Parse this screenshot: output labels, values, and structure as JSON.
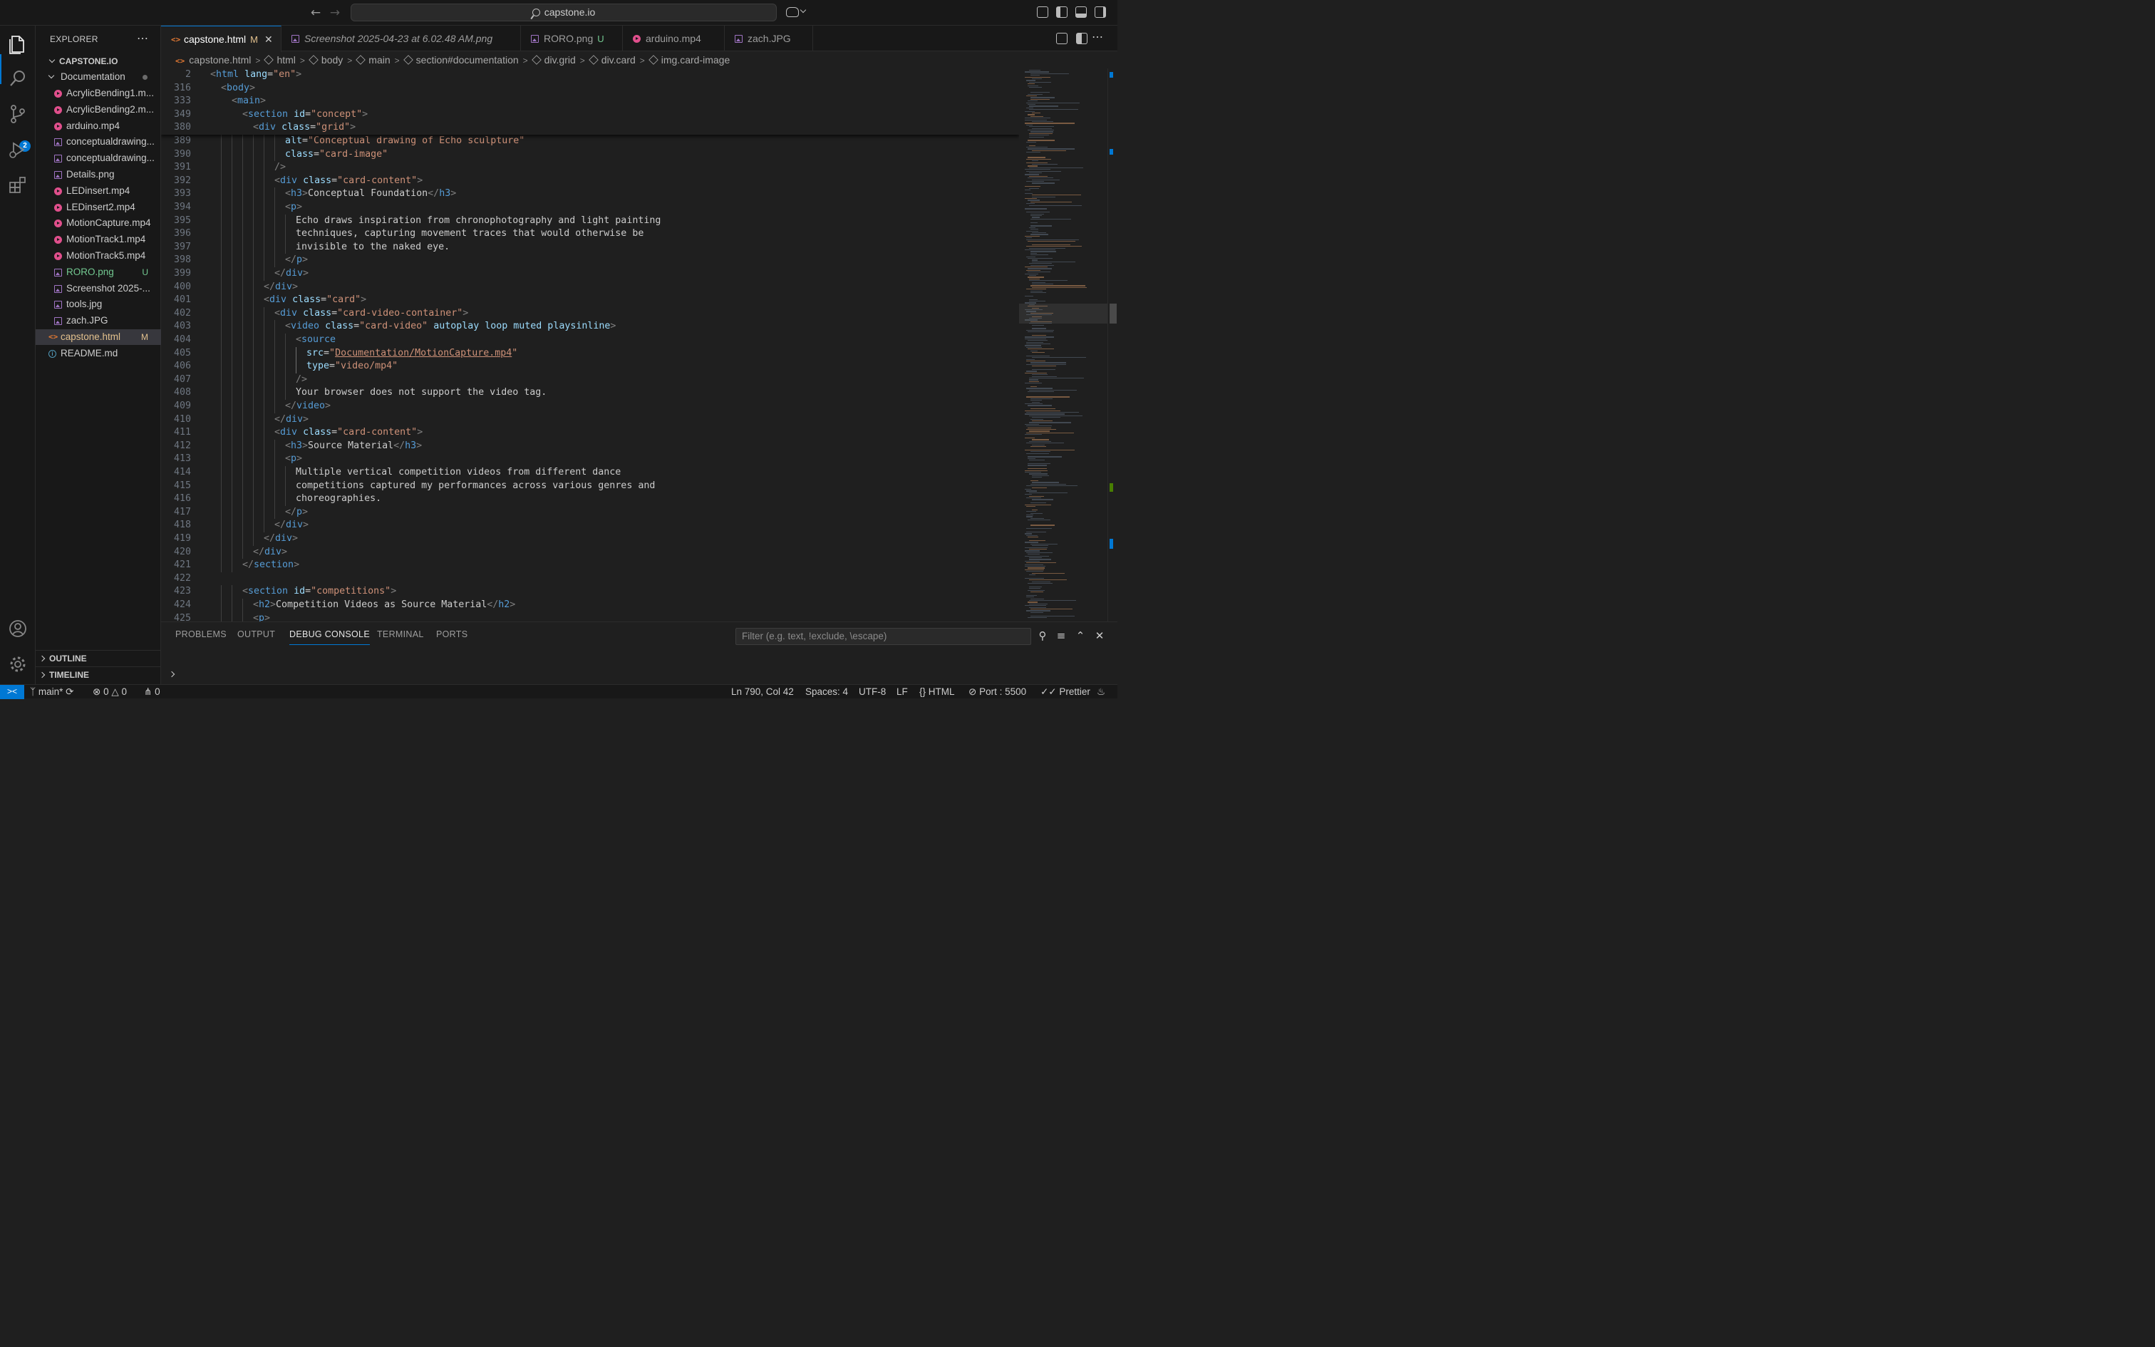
{
  "titlebar": {
    "search": "capstone.io"
  },
  "sidebar": {
    "title": "EXPLORER",
    "root": "CAPSTONE.IO",
    "folder": "Documentation",
    "files": [
      {
        "name": "AcrylicBending1.m...",
        "type": "video",
        "status": ""
      },
      {
        "name": "AcrylicBending2.m...",
        "type": "video",
        "status": ""
      },
      {
        "name": "arduino.mp4",
        "type": "video",
        "status": ""
      },
      {
        "name": "conceptualdrawing...",
        "type": "image",
        "status": ""
      },
      {
        "name": "conceptualdrawing...",
        "type": "image",
        "status": ""
      },
      {
        "name": "Details.png",
        "type": "image",
        "status": ""
      },
      {
        "name": "LEDinsert.mp4",
        "type": "video",
        "status": ""
      },
      {
        "name": "LEDinsert2.mp4",
        "type": "video",
        "status": ""
      },
      {
        "name": "MotionCapture.mp4",
        "type": "video",
        "status": ""
      },
      {
        "name": "MotionTrack1.mp4",
        "type": "video",
        "status": ""
      },
      {
        "name": "MotionTrack5.mp4",
        "type": "video",
        "status": ""
      },
      {
        "name": "RORO.png",
        "type": "image",
        "status": "U"
      },
      {
        "name": "Screenshot 2025-...",
        "type": "image",
        "status": ""
      },
      {
        "name": "tools.jpg",
        "type": "image",
        "status": ""
      },
      {
        "name": "zach.JPG",
        "type": "image",
        "status": ""
      }
    ],
    "root_files": [
      {
        "name": "capstone.html",
        "type": "html",
        "status": "M"
      },
      {
        "name": "README.md",
        "type": "info",
        "status": ""
      }
    ],
    "outline": "OUTLINE",
    "timeline": "TIMELINE"
  },
  "activity_badge": "2",
  "tabs": [
    {
      "label": "capstone.html",
      "mod": "M",
      "icon": "html-icon"
    },
    {
      "label": "Screenshot 2025-04-23 at 6.02.48 AM.png",
      "mod": "",
      "icon": "image-icon"
    },
    {
      "label": "RORO.png",
      "mod": "U",
      "icon": "image-icon"
    },
    {
      "label": "arduino.mp4",
      "mod": "",
      "icon": "video-icon"
    },
    {
      "label": "zach.JPG",
      "mod": "",
      "icon": "image-icon"
    }
  ],
  "breadcrumb": [
    "capstone.html",
    "html",
    "body",
    "main",
    "section#documentation",
    "div.grid",
    "div.card",
    "img.card-image"
  ],
  "sticky": [
    {
      "ln": "2",
      "indent": 0,
      "tokens": [
        [
          "tg",
          "<"
        ],
        [
          "tn",
          "html"
        ],
        [
          "eq",
          " "
        ],
        [
          "an",
          "lang"
        ],
        [
          "eq",
          "="
        ],
        [
          "av",
          "\"en\""
        ],
        [
          "tg",
          ">"
        ]
      ]
    },
    {
      "ln": "316",
      "indent": 1,
      "tokens": [
        [
          "tg",
          "<"
        ],
        [
          "tn",
          "body"
        ],
        [
          "tg",
          ">"
        ]
      ]
    },
    {
      "ln": "333",
      "indent": 2,
      "tokens": [
        [
          "tg",
          "<"
        ],
        [
          "tn",
          "main"
        ],
        [
          "tg",
          ">"
        ]
      ]
    },
    {
      "ln": "349",
      "indent": 3,
      "tokens": [
        [
          "tg",
          "<"
        ],
        [
          "tn",
          "section"
        ],
        [
          "eq",
          " "
        ],
        [
          "an",
          "id"
        ],
        [
          "eq",
          "="
        ],
        [
          "av",
          "\"concept\""
        ],
        [
          "tg",
          ">"
        ]
      ]
    },
    {
      "ln": "380",
      "indent": 4,
      "tokens": [
        [
          "tg",
          "<"
        ],
        [
          "tn",
          "div"
        ],
        [
          "eq",
          " "
        ],
        [
          "an",
          "class"
        ],
        [
          "eq",
          "="
        ],
        [
          "av",
          "\"grid\""
        ],
        [
          "tg",
          ">"
        ]
      ]
    }
  ],
  "lines": [
    {
      "ln": "389",
      "indent": 7,
      "tokens": [
        [
          "an",
          "alt"
        ],
        [
          "eq",
          "="
        ],
        [
          "av",
          "\"Conceptual drawing of Echo sculpture\""
        ]
      ]
    },
    {
      "ln": "390",
      "indent": 7,
      "tokens": [
        [
          "an",
          "class"
        ],
        [
          "eq",
          "="
        ],
        [
          "av",
          "\"card-image\""
        ]
      ]
    },
    {
      "ln": "391",
      "indent": 6,
      "tokens": [
        [
          "tg",
          "/>"
        ]
      ]
    },
    {
      "ln": "392",
      "indent": 6,
      "tokens": [
        [
          "tg",
          "<"
        ],
        [
          "tn",
          "div"
        ],
        [
          "eq",
          " "
        ],
        [
          "an",
          "class"
        ],
        [
          "eq",
          "="
        ],
        [
          "av",
          "\"card-content\""
        ],
        [
          "tg",
          ">"
        ]
      ]
    },
    {
      "ln": "393",
      "indent": 7,
      "tokens": [
        [
          "tg",
          "<"
        ],
        [
          "tn",
          "h3"
        ],
        [
          "tg",
          ">"
        ],
        [
          "eq",
          "Conceptual Foundation"
        ],
        [
          "tg",
          "</"
        ],
        [
          "tn",
          "h3"
        ],
        [
          "tg",
          ">"
        ]
      ]
    },
    {
      "ln": "394",
      "indent": 7,
      "tokens": [
        [
          "tg",
          "<"
        ],
        [
          "tn",
          "p"
        ],
        [
          "tg",
          ">"
        ]
      ]
    },
    {
      "ln": "395",
      "indent": 8,
      "tokens": [
        [
          "eq",
          "Echo draws inspiration from chronophotography and light painting"
        ]
      ]
    },
    {
      "ln": "396",
      "indent": 8,
      "tokens": [
        [
          "eq",
          "techniques, capturing movement traces that would otherwise be"
        ]
      ]
    },
    {
      "ln": "397",
      "indent": 8,
      "tokens": [
        [
          "eq",
          "invisible to the naked eye."
        ]
      ]
    },
    {
      "ln": "398",
      "indent": 7,
      "tokens": [
        [
          "tg",
          "</"
        ],
        [
          "tn",
          "p"
        ],
        [
          "tg",
          ">"
        ]
      ]
    },
    {
      "ln": "399",
      "indent": 6,
      "tokens": [
        [
          "tg",
          "</"
        ],
        [
          "tn",
          "div"
        ],
        [
          "tg",
          ">"
        ]
      ]
    },
    {
      "ln": "400",
      "indent": 5,
      "tokens": [
        [
          "tg",
          "</"
        ],
        [
          "tn",
          "div"
        ],
        [
          "tg",
          ">"
        ]
      ]
    },
    {
      "ln": "401",
      "indent": 5,
      "tokens": [
        [
          "tg",
          "<"
        ],
        [
          "tn",
          "div"
        ],
        [
          "eq",
          " "
        ],
        [
          "an",
          "class"
        ],
        [
          "eq",
          "="
        ],
        [
          "av",
          "\"card\""
        ],
        [
          "tg",
          ">"
        ]
      ]
    },
    {
      "ln": "402",
      "indent": 6,
      "tokens": [
        [
          "tg",
          "<"
        ],
        [
          "tn",
          "div"
        ],
        [
          "eq",
          " "
        ],
        [
          "an",
          "class"
        ],
        [
          "eq",
          "="
        ],
        [
          "av",
          "\"card-video-container\""
        ],
        [
          "tg",
          ">"
        ]
      ]
    },
    {
      "ln": "403",
      "indent": 7,
      "tokens": [
        [
          "tg",
          "<"
        ],
        [
          "tn",
          "video"
        ],
        [
          "eq",
          " "
        ],
        [
          "an",
          "class"
        ],
        [
          "eq",
          "="
        ],
        [
          "av",
          "\"card-video\""
        ],
        [
          "eq",
          " "
        ],
        [
          "an",
          "autoplay loop muted playsinline"
        ],
        [
          "tg",
          ">"
        ]
      ]
    },
    {
      "ln": "404",
      "indent": 8,
      "tokens": [
        [
          "tg",
          "<"
        ],
        [
          "tn",
          "source"
        ]
      ]
    },
    {
      "ln": "405",
      "indent": 9,
      "tokens": [
        [
          "an",
          "src"
        ],
        [
          "eq",
          "="
        ],
        [
          "av",
          "\""
        ],
        [
          "avl",
          "Documentation/MotionCapture.mp4"
        ],
        [
          "av",
          "\""
        ]
      ]
    },
    {
      "ln": "406",
      "indent": 9,
      "tokens": [
        [
          "an",
          "type"
        ],
        [
          "eq",
          "="
        ],
        [
          "av",
          "\"video/mp4\""
        ]
      ]
    },
    {
      "ln": "407",
      "indent": 8,
      "tokens": [
        [
          "tg",
          "/>"
        ]
      ]
    },
    {
      "ln": "408",
      "indent": 8,
      "tokens": [
        [
          "eq",
          "Your browser does not support the video tag."
        ]
      ]
    },
    {
      "ln": "409",
      "indent": 7,
      "tokens": [
        [
          "tg",
          "</"
        ],
        [
          "tn",
          "video"
        ],
        [
          "tg",
          ">"
        ]
      ]
    },
    {
      "ln": "410",
      "indent": 6,
      "tokens": [
        [
          "tg",
          "</"
        ],
        [
          "tn",
          "div"
        ],
        [
          "tg",
          ">"
        ]
      ]
    },
    {
      "ln": "411",
      "indent": 6,
      "tokens": [
        [
          "tg",
          "<"
        ],
        [
          "tn",
          "div"
        ],
        [
          "eq",
          " "
        ],
        [
          "an",
          "class"
        ],
        [
          "eq",
          "="
        ],
        [
          "av",
          "\"card-content\""
        ],
        [
          "tg",
          ">"
        ]
      ]
    },
    {
      "ln": "412",
      "indent": 7,
      "tokens": [
        [
          "tg",
          "<"
        ],
        [
          "tn",
          "h3"
        ],
        [
          "tg",
          ">"
        ],
        [
          "eq",
          "Source Material"
        ],
        [
          "tg",
          "</"
        ],
        [
          "tn",
          "h3"
        ],
        [
          "tg",
          ">"
        ]
      ]
    },
    {
      "ln": "413",
      "indent": 7,
      "tokens": [
        [
          "tg",
          "<"
        ],
        [
          "tn",
          "p"
        ],
        [
          "tg",
          ">"
        ]
      ]
    },
    {
      "ln": "414",
      "indent": 8,
      "tokens": [
        [
          "eq",
          "Multiple vertical competition videos from different dance"
        ]
      ]
    },
    {
      "ln": "415",
      "indent": 8,
      "tokens": [
        [
          "eq",
          "competitions captured my performances across various genres and"
        ]
      ]
    },
    {
      "ln": "416",
      "indent": 8,
      "tokens": [
        [
          "eq",
          "choreographies."
        ]
      ]
    },
    {
      "ln": "417",
      "indent": 7,
      "tokens": [
        [
          "tg",
          "</"
        ],
        [
          "tn",
          "p"
        ],
        [
          "tg",
          ">"
        ]
      ]
    },
    {
      "ln": "418",
      "indent": 6,
      "tokens": [
        [
          "tg",
          "</"
        ],
        [
          "tn",
          "div"
        ],
        [
          "tg",
          ">"
        ]
      ]
    },
    {
      "ln": "419",
      "indent": 5,
      "tokens": [
        [
          "tg",
          "</"
        ],
        [
          "tn",
          "div"
        ],
        [
          "tg",
          ">"
        ]
      ]
    },
    {
      "ln": "420",
      "indent": 4,
      "tokens": [
        [
          "tg",
          "</"
        ],
        [
          "tn",
          "div"
        ],
        [
          "tg",
          ">"
        ]
      ]
    },
    {
      "ln": "421",
      "indent": 3,
      "tokens": [
        [
          "tg",
          "</"
        ],
        [
          "tn",
          "section"
        ],
        [
          "tg",
          ">"
        ]
      ]
    },
    {
      "ln": "422",
      "indent": 0,
      "tokens": []
    },
    {
      "ln": "423",
      "indent": 3,
      "tokens": [
        [
          "tg",
          "<"
        ],
        [
          "tn",
          "section"
        ],
        [
          "eq",
          " "
        ],
        [
          "an",
          "id"
        ],
        [
          "eq",
          "="
        ],
        [
          "av",
          "\"competitions\""
        ],
        [
          "tg",
          ">"
        ]
      ]
    },
    {
      "ln": "424",
      "indent": 4,
      "tokens": [
        [
          "tg",
          "<"
        ],
        [
          "tn",
          "h2"
        ],
        [
          "tg",
          ">"
        ],
        [
          "eq",
          "Competition Videos as Source Material"
        ],
        [
          "tg",
          "</"
        ],
        [
          "tn",
          "h2"
        ],
        [
          "tg",
          ">"
        ]
      ]
    },
    {
      "ln": "425",
      "indent": 4,
      "tokens": [
        [
          "tg",
          "<"
        ],
        [
          "tn",
          "p"
        ],
        [
          "tg",
          ">"
        ]
      ]
    }
  ],
  "panel": {
    "tabs": [
      "PROBLEMS",
      "OUTPUT",
      "DEBUG CONSOLE",
      "TERMINAL",
      "PORTS"
    ],
    "active": "DEBUG CONSOLE",
    "filter_placeholder": "Filter (e.g. text, !exclude, \\escape)"
  },
  "status": {
    "branch": "main*",
    "errors": "0",
    "warnings": "0",
    "ports": "0",
    "position": "Ln 790, Col 42",
    "spaces": "Spaces: 4",
    "encoding": "UTF-8",
    "eol": "LF",
    "language": "HTML",
    "port": "Port : 5500",
    "formatter": "Prettier"
  },
  "colors": {
    "accent": "#0078d4",
    "tag": "#569cd6",
    "attr": "#9cdcfe",
    "string": "#ce9178",
    "modified": "#e2c08d"
  }
}
